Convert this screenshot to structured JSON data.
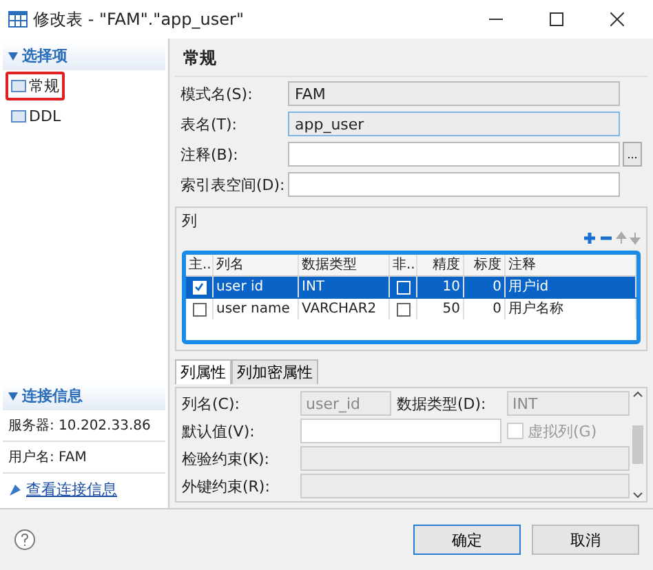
{
  "window": {
    "title": "修改表 - \"FAM\".\"app_user\""
  },
  "sidebar": {
    "section_title": "选择项",
    "items": [
      {
        "label": "常规",
        "selected": true
      },
      {
        "label": "DDL",
        "selected": false
      }
    ],
    "connection_title": "连接信息",
    "connection_lines": [
      "服务器: 10.202.33.86",
      "用户名: FAM"
    ],
    "connection_link": "查看连接信息"
  },
  "general": {
    "heading": "常规",
    "fields": [
      {
        "label": "模式名(S):",
        "value": "FAM",
        "kind": "readonly"
      },
      {
        "label": "表名(T):",
        "value": "app_user",
        "kind": "focused"
      },
      {
        "label": "注释(B):",
        "kind": "browse",
        "button": "..."
      },
      {
        "label": "索引表空间(D):",
        "kind": "plain"
      }
    ]
  },
  "columns": {
    "title": "列",
    "table_columns": [
      "主...",
      "列名",
      "数据类型",
      "非...",
      "精度",
      "标度",
      "注释"
    ],
    "rows": [
      {
        "primary": true,
        "name": "user id",
        "type": "INT",
        "not_null": false,
        "precision": "10",
        "scale": "0",
        "comment": "用户id",
        "selected": true
      },
      {
        "primary": false,
        "name": "user name",
        "type": "VARCHAR2",
        "not_null": false,
        "precision": "50",
        "scale": "0",
        "comment": "用户名称",
        "selected": false
      }
    ]
  },
  "property_tabs": [
    {
      "label": "列属性",
      "selected": true
    },
    {
      "label": "列加密属性",
      "selected": false
    }
  ],
  "properties": {
    "column_name_label": "列名(C):",
    "column_name": "user_id",
    "data_type_label": "数据类型(D):",
    "data_type": "INT",
    "default_label": "默认值(V):",
    "virtual_label": "虚拟列(G)",
    "virtual_checked": false,
    "check_label": "检验约束(K):",
    "fk_label": "外键约束(R):"
  },
  "buttons": [
    "确定",
    "取消"
  ]
}
